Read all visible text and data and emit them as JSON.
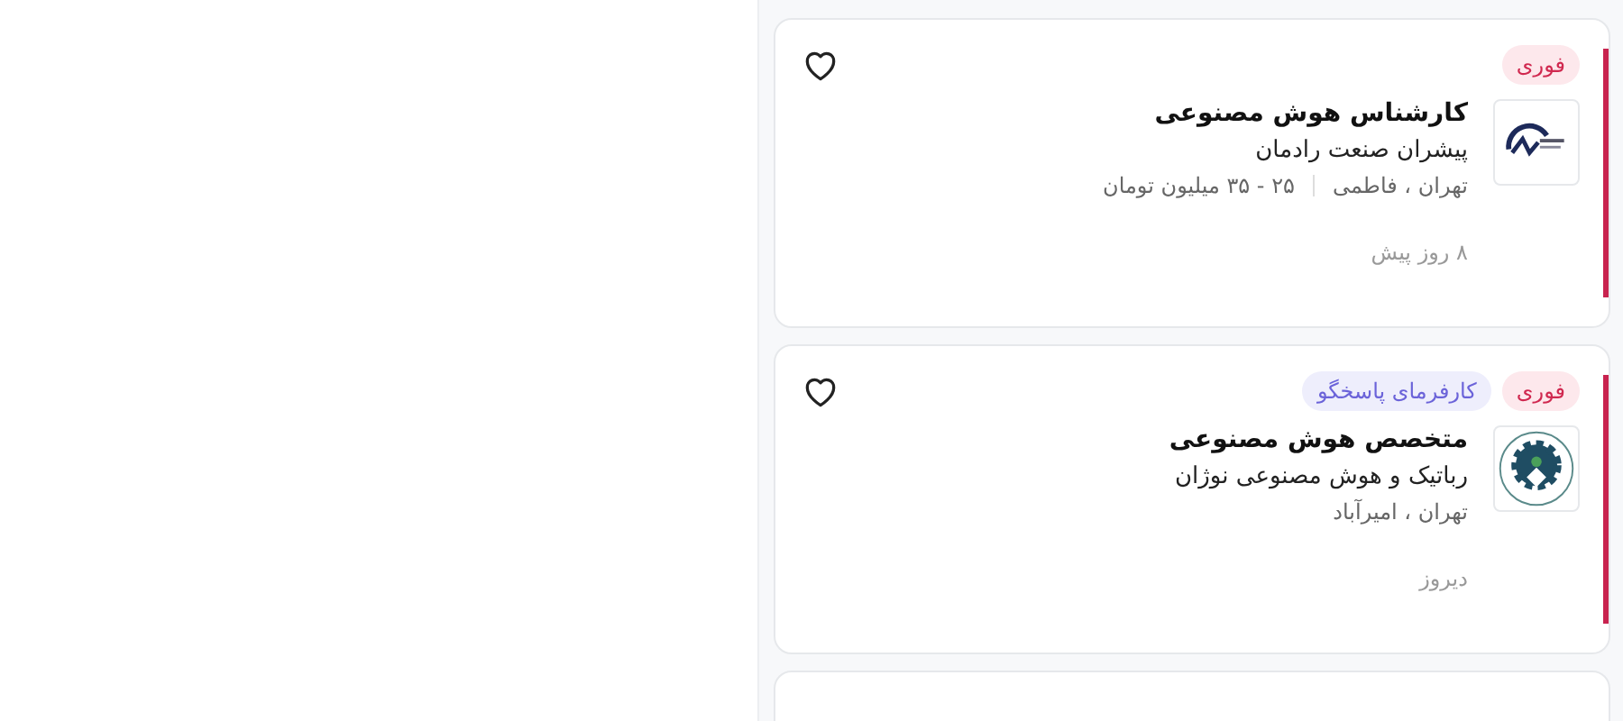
{
  "jobs": [
    {
      "badges": [
        {
          "kind": "urgent",
          "label": "فوری"
        }
      ],
      "saved": false,
      "featured": true,
      "logo": {
        "kind": "wave"
      },
      "title": "کارشناس هوش مصنوعی",
      "company": "پیشران صنعت رادمان",
      "location": "تهران ، فاطمی",
      "salary": "۲۵ - ۳۵ میلیون تومان",
      "posted": "۸ روز پیش"
    },
    {
      "badges": [
        {
          "kind": "urgent",
          "label": "فوری"
        },
        {
          "kind": "responsive",
          "label": "کارفرمای پاسخگو"
        }
      ],
      "saved": false,
      "featured": true,
      "logo": {
        "kind": "gear"
      },
      "title": "متخصص هوش مصنوعی",
      "company": "رباتیک و هوش مصنوعی نوژان",
      "location": "تهران ، امیرآباد",
      "posted": "دیروز"
    }
  ]
}
